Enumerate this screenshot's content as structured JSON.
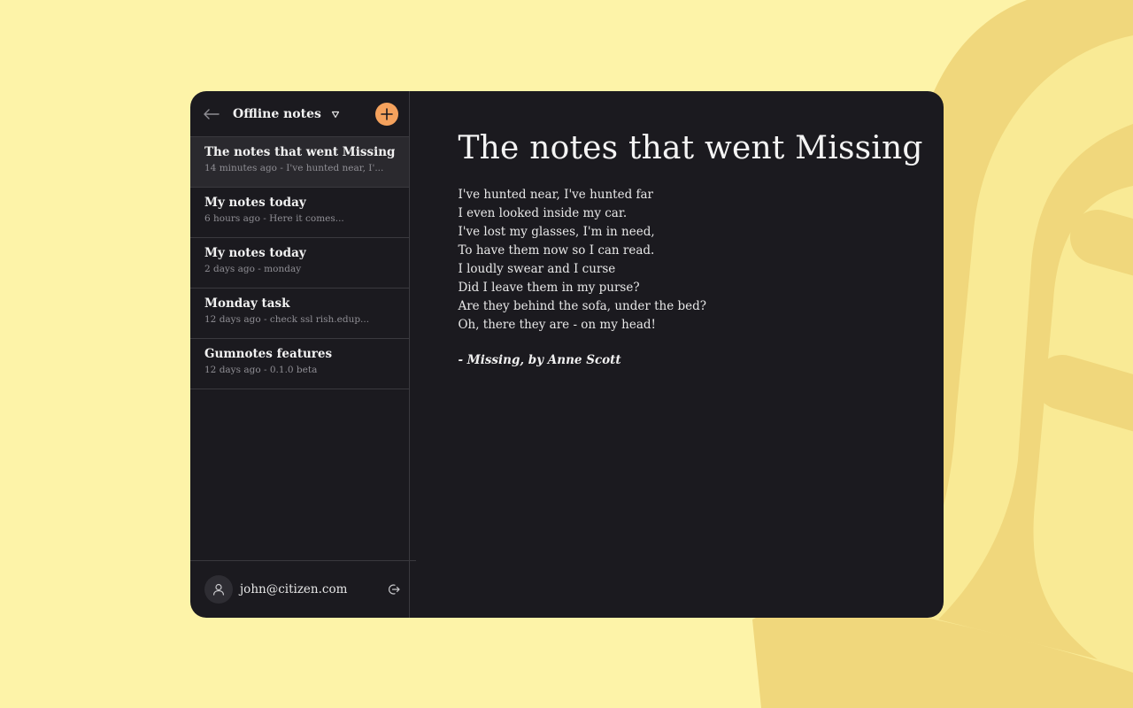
{
  "sidebar": {
    "title": "Offline notes",
    "notes": [
      {
        "title": "The notes that went Missing",
        "meta": "14 minutes ago - I've hunted near, I'..."
      },
      {
        "title": "My notes today",
        "meta": "6 hours ago - Here it comes..."
      },
      {
        "title": "My notes today",
        "meta": "2 days ago - monday"
      },
      {
        "title": "Monday task",
        "meta": "12 days ago - check ssl rish.edup..."
      },
      {
        "title": "Gumnotes features",
        "meta": "12 days ago - 0.1.0 beta"
      }
    ],
    "user_email": "john@citizen.com"
  },
  "editor": {
    "title": "The notes that went Missing",
    "lines": [
      "I've hunted near, I've hunted far",
      "I even looked inside my car.",
      "I've lost my glasses, I'm in need,",
      "To have them now so I can read.",
      "I loudly swear and I curse",
      "Did I leave them in my purse?",
      "Are they behind the sofa, under the bed?",
      "Oh, there they are - on my head!"
    ],
    "signature": "- Missing, by Anne Scott"
  },
  "colors": {
    "background": "#fdf3a8",
    "window": "#1b1a1f",
    "accent": "#f5a25d",
    "active_item": "#2a292e"
  },
  "icons": {
    "back": "arrow-left-icon",
    "caret": "triangle-down-icon",
    "add": "plus-icon",
    "avatar": "user-icon",
    "logout": "logout-icon"
  }
}
